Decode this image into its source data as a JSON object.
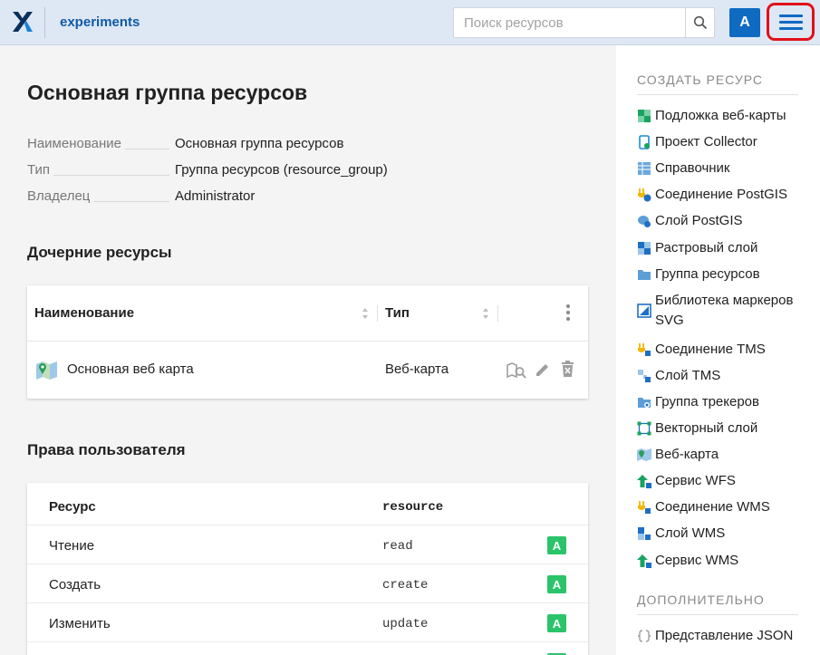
{
  "header": {
    "app_title": "experiments",
    "search_placeholder": "Поиск ресурсов",
    "avatar_letter": "A"
  },
  "page": {
    "title": "Основная группа ресурсов",
    "props": [
      {
        "key": "Наименование",
        "value": "Основная группа ресурсов"
      },
      {
        "key": "Тип",
        "value": "Группа ресурсов (resource_group)"
      },
      {
        "key": "Владелец",
        "value": "Administrator"
      }
    ]
  },
  "children": {
    "heading": "Дочерние ресурсы",
    "col_name": "Наименование",
    "col_type": "Тип",
    "rows": [
      {
        "name": "Основная веб карта",
        "type": "Веб-карта"
      }
    ]
  },
  "permissions": {
    "heading": "Права пользователя",
    "col_resource": "Ресурс",
    "col_code": "resource",
    "rows": [
      {
        "label": "Чтение",
        "code": "read",
        "badge": "A"
      },
      {
        "label": "Создать",
        "code": "create",
        "badge": "A"
      },
      {
        "label": "Изменить",
        "code": "update",
        "badge": "A"
      }
    ]
  },
  "sidebar": {
    "create_heading": "СОЗДАТЬ РЕСУРС",
    "create_items": [
      {
        "label": "Подложка веб-карты",
        "icon": "basemap-icon"
      },
      {
        "label": "Проект Collector",
        "icon": "collector-icon"
      },
      {
        "label": "Справочник",
        "icon": "lookup-table-icon"
      },
      {
        "label": "Соединение PostGIS",
        "icon": "postgis-connection-icon"
      },
      {
        "label": "Слой PostGIS",
        "icon": "postgis-layer-icon"
      },
      {
        "label": "Растровый слой",
        "icon": "raster-layer-icon"
      },
      {
        "label": "Группа ресурсов",
        "icon": "folder-icon"
      },
      {
        "label": "Библиотека маркеров SVG",
        "icon": "svg-marker-library-icon"
      },
      {
        "label": "Соединение TMS",
        "icon": "tms-connection-icon"
      },
      {
        "label": "Слой TMS",
        "icon": "tms-layer-icon"
      },
      {
        "label": "Группа трекеров",
        "icon": "tracker-group-icon"
      },
      {
        "label": "Векторный слой",
        "icon": "vector-layer-icon"
      },
      {
        "label": "Веб-карта",
        "icon": "webmap-icon"
      },
      {
        "label": "Сервис WFS",
        "icon": "wfs-service-icon"
      },
      {
        "label": "Соединение WMS",
        "icon": "wms-connection-icon"
      },
      {
        "label": "Слой WMS",
        "icon": "wms-layer-icon"
      },
      {
        "label": "Сервис WMS",
        "icon": "wms-service-icon"
      }
    ],
    "extra_heading": "ДОПОЛНИТЕЛЬНО",
    "extra_items": [
      {
        "label": "Представление JSON",
        "icon": "json-icon"
      }
    ]
  },
  "colors": {
    "accent": "#0f6ac2",
    "header_bg": "#dde8f4",
    "highlight_outline": "#e2101a",
    "permission_green": "#2bc46a"
  }
}
